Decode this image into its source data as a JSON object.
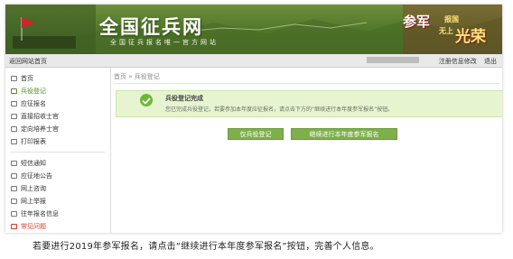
{
  "banner": {
    "title": "全国征兵网",
    "subtitle": "全国征兵报名唯一官方网站",
    "slogan_1": "参军",
    "slogan_2": "报国",
    "slogan_3": "无上",
    "slogan_4": "光荣"
  },
  "topbar": {
    "home": "返回网站首页",
    "links": [
      "注册信息修改",
      "退出"
    ]
  },
  "sidebar": {
    "items": [
      {
        "label": "首页",
        "icon": "home-icon"
      },
      {
        "label": "兵役登记",
        "icon": "register-icon",
        "state": "active"
      },
      {
        "label": "应征报名",
        "icon": "form-icon"
      },
      {
        "label": "直接招收士官",
        "icon": "form-icon"
      },
      {
        "label": "定向培养士官",
        "icon": "form-icon"
      },
      {
        "label": "打印报表",
        "icon": "print-icon"
      },
      {
        "label": "短信通知",
        "icon": "message-icon"
      },
      {
        "label": "应征地公告",
        "icon": "notice-icon"
      },
      {
        "label": "网上咨询",
        "icon": "chat-icon"
      },
      {
        "label": "网上举报",
        "icon": "report-icon"
      },
      {
        "label": "往年报名信息",
        "icon": "history-icon"
      },
      {
        "label": "常见问题",
        "icon": "faq-icon",
        "state": "highlight"
      }
    ]
  },
  "breadcrumb": {
    "home": "首页",
    "sep": "»",
    "current": "兵役登记"
  },
  "success": {
    "title": "兵役登记完成",
    "message": "您已完成兵役登记，若要参加本年度应征报名，请点击下方的“继续进行本年度参军报名”按钮。"
  },
  "buttons": {
    "print": "仅兵役登记",
    "continue": "继续进行本年度参军报名"
  },
  "caption": "若要进行2019年参军报名，请点击“继续进行本年度参军报名”按钮，完善个人信息。",
  "colors": {
    "brand_green": "#547a2c",
    "button_green": "#7eb04a",
    "success_bg": "#e6f5cf",
    "highlight_red": "#d23a2a"
  }
}
